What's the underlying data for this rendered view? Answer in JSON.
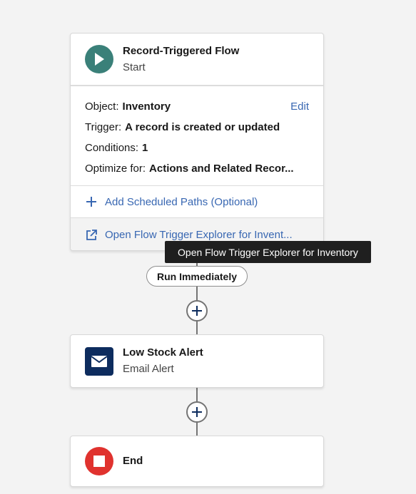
{
  "start_element": {
    "title": "Record-Triggered Flow",
    "subtitle": "Start",
    "icon": "play-icon",
    "details": [
      {
        "label": "Object:",
        "value": "Inventory"
      },
      {
        "label": "Trigger:",
        "value": "A record is created or updated"
      },
      {
        "label": "Conditions:",
        "value": "1"
      },
      {
        "label": "Optimize for:",
        "value": "Actions and Related Recor..."
      }
    ],
    "edit_label": "Edit",
    "add_scheduled_paths_label": "Add Scheduled Paths (Optional)",
    "open_explorer_label": "Open Flow Trigger Explorer for Invent..."
  },
  "tooltip": {
    "text": "Open Flow Trigger Explorer for Inventory"
  },
  "path_label": "Run Immediately",
  "email_element": {
    "title": "Low Stock Alert",
    "subtitle": "Email Alert",
    "icon": "envelope-icon"
  },
  "end_element": {
    "title": "End",
    "icon": "stop-icon"
  },
  "colors": {
    "start_icon_bg": "#3a8079",
    "email_icon_bg": "#0d2c5e",
    "end_icon_bg": "#e0322e",
    "link": "#3867b2",
    "connector": "#747474",
    "canvas": "#f3f3f3"
  }
}
